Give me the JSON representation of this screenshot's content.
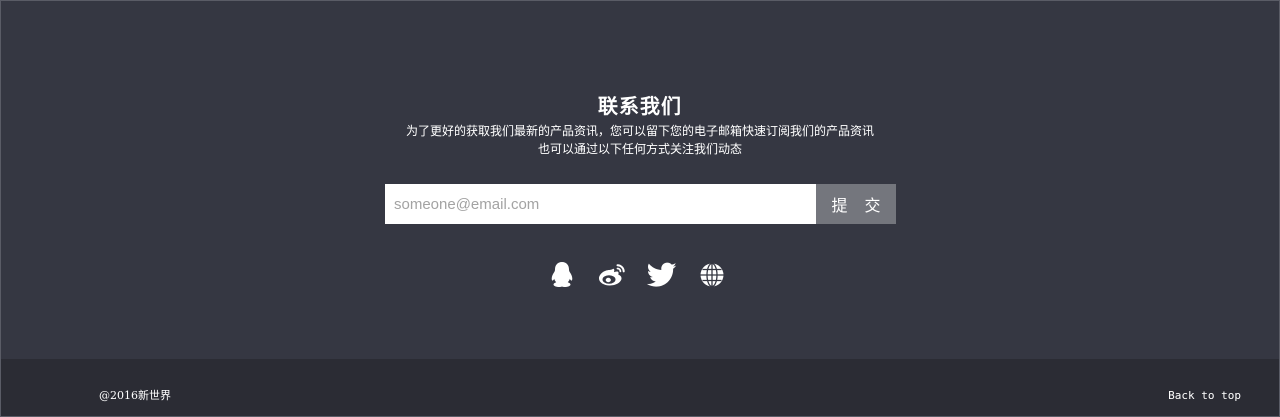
{
  "contact": {
    "title": "联系我们",
    "desc_line1": "为了更好的获取我们最新的产品资讯，您可以留下您的电子邮箱快速订阅我们的产品资讯",
    "desc_line2": "也可以通过以下任何方式关注我们动态",
    "email_placeholder": "someone@email.com",
    "submit_label": "提 交",
    "social_icons": [
      "qq-icon",
      "weibo-icon",
      "twitter-icon",
      "globe-icon"
    ]
  },
  "footer": {
    "copyright": "@2016新世界",
    "back_to_top": "Back to top"
  },
  "colors": {
    "background": "#353742",
    "footer_background": "#2b2c34",
    "button": "#74767d",
    "text": "#ffffff"
  }
}
